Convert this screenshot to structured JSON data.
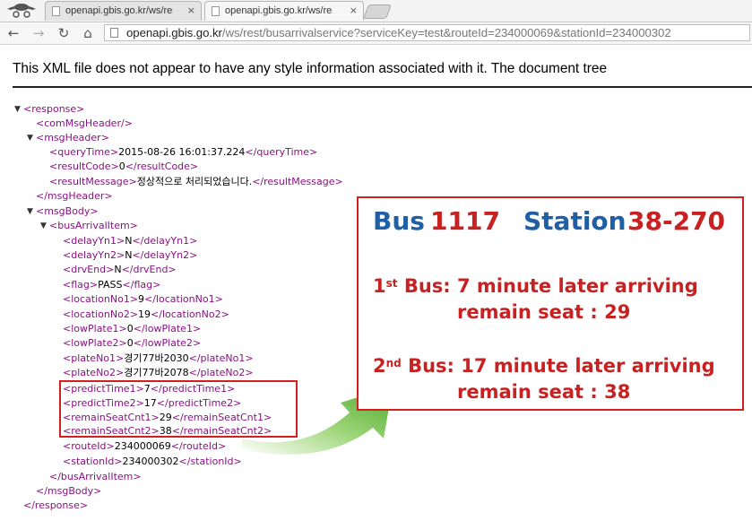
{
  "browser": {
    "tabs": [
      {
        "title": "openapi.gbis.go.kr/ws/res",
        "close": "×"
      },
      {
        "title": "openapi.gbis.go.kr/ws/res",
        "close": "×"
      }
    ],
    "url_host": "openapi.gbis.go.kr",
    "url_rest": "/ws/rest/busarrivalservice?serviceKey=test&routeId=234000069&stationId=234000302",
    "nav": {
      "back": "←",
      "forward": "→",
      "reload": "↻",
      "home": "⌂"
    }
  },
  "notice": "This XML file does not appear to have any style information associated with it. The document tree",
  "xml": {
    "lines": [
      {
        "tag_open": "<response>",
        "text": "",
        "tag_close": ""
      },
      {
        "tag_open": "<comMsgHeader/>",
        "text": "",
        "tag_close": ""
      },
      {
        "tag_open": "<msgHeader>",
        "text": "",
        "tag_close": ""
      },
      {
        "tag_open": "<queryTime>",
        "text": "2015-08-26 16:01:37.224",
        "tag_close": "</queryTime>"
      },
      {
        "tag_open": "<resultCode>",
        "text": "0",
        "tag_close": "</resultCode>"
      },
      {
        "tag_open": "<resultMessage>",
        "text": "정상적으로 처리되었습니다.",
        "tag_close": "</resultMessage>"
      },
      {
        "tag_open": "</msgHeader>",
        "text": "",
        "tag_close": ""
      },
      {
        "tag_open": "<msgBody>",
        "text": "",
        "tag_close": ""
      },
      {
        "tag_open": "<busArrivalItem>",
        "text": "",
        "tag_close": ""
      },
      {
        "tag_open": "<delayYn1>",
        "text": "N",
        "tag_close": "</delayYn1>"
      },
      {
        "tag_open": "<delayYn2>",
        "text": "N",
        "tag_close": "</delayYn2>"
      },
      {
        "tag_open": "<drvEnd>",
        "text": "N",
        "tag_close": "</drvEnd>"
      },
      {
        "tag_open": "<flag>",
        "text": "PASS",
        "tag_close": "</flag>"
      },
      {
        "tag_open": "<locationNo1>",
        "text": "9",
        "tag_close": "</locationNo1>"
      },
      {
        "tag_open": "<locationNo2>",
        "text": "19",
        "tag_close": "</locationNo2>"
      },
      {
        "tag_open": "<lowPlate1>",
        "text": "0",
        "tag_close": "</lowPlate1>"
      },
      {
        "tag_open": "<lowPlate2>",
        "text": "0",
        "tag_close": "</lowPlate2>"
      },
      {
        "tag_open": "<plateNo1>",
        "text": "경기77바2030",
        "tag_close": "</plateNo1>"
      },
      {
        "tag_open": "<plateNo2>",
        "text": "경기77바2078",
        "tag_close": "</plateNo2>"
      },
      {
        "tag_open": "<predictTime1>",
        "text": "7",
        "tag_close": "</predictTime1>"
      },
      {
        "tag_open": "<predictTime2>",
        "text": "17",
        "tag_close": "</predictTime2>"
      },
      {
        "tag_open": "<remainSeatCnt1>",
        "text": "29",
        "tag_close": "</remainSeatCnt1>"
      },
      {
        "tag_open": "<remainSeatCnt2>",
        "text": "38",
        "tag_close": "</remainSeatCnt2>"
      },
      {
        "tag_open": "<routeId>",
        "text": "234000069",
        "tag_close": "</routeId>"
      },
      {
        "tag_open": "<stationId>",
        "text": "234000302",
        "tag_close": "</stationId>"
      },
      {
        "tag_open": "</busArrivalItem>",
        "text": "",
        "tag_close": ""
      },
      {
        "tag_open": "</msgBody>",
        "text": "",
        "tag_close": ""
      },
      {
        "tag_open": "</response>",
        "text": "",
        "tag_close": ""
      }
    ],
    "toggle_glyph": "▼"
  },
  "callout": {
    "bus_word": "Bus",
    "bus_number": "1117",
    "station_word": "Station",
    "station_number": "38-270",
    "first_ordinal": "1",
    "first_suffix": "st",
    "first_text": " Bus: 7 minute later arriving",
    "first_seat": "remain seat : 29",
    "second_ordinal": "2",
    "second_suffix": "nd",
    "second_text": " Bus: 17 minute later arriving",
    "second_seat": "remain seat : 38"
  },
  "colors": {
    "tag": "#881280",
    "callout_blue": "#1f5fa5",
    "callout_red": "#c82121",
    "highlight": "#d61e1e",
    "arrow_green": "#5cb82e"
  }
}
